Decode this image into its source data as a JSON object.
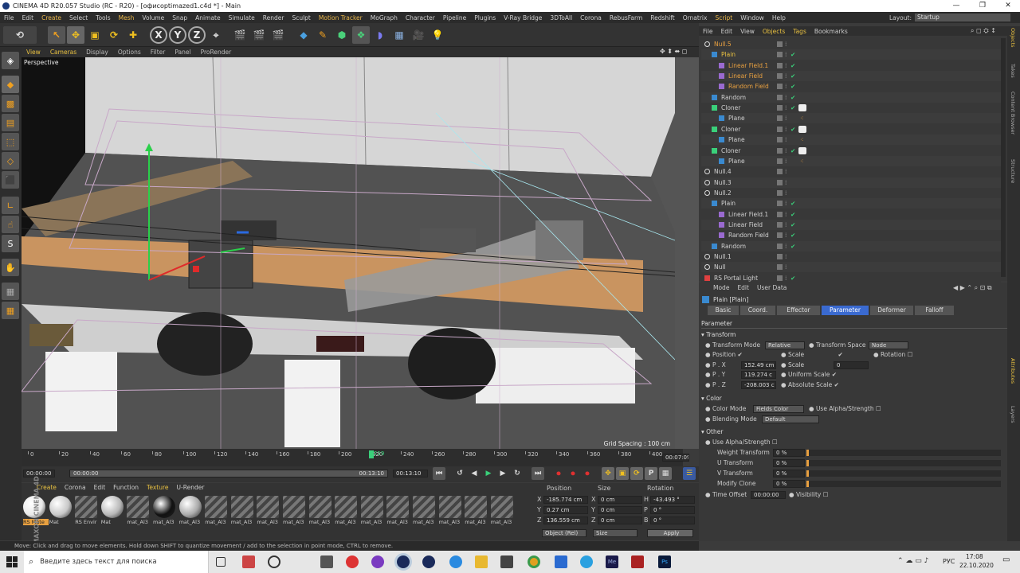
{
  "window": {
    "title": "CINEMA 4D R20.057 Studio (RC - R20) - [офисoptimazed1.c4d *] - Main",
    "min_label": "—",
    "max_label": "❐",
    "close_label": "✕"
  },
  "menu": {
    "items": [
      "File",
      "Edit",
      "Create",
      "Select",
      "Tools",
      "Mesh",
      "Volume",
      "Snap",
      "Animate",
      "Simulate",
      "Render",
      "Sculpt",
      "Motion Tracker",
      "MoGraph",
      "Character",
      "Pipeline",
      "Plugins",
      "V-Ray Bridge",
      "3DToAll",
      "Corona",
      "RebusFarm",
      "Redshift",
      "Ornatrix",
      "Script",
      "Window",
      "Help"
    ],
    "layout_label": "Layout:",
    "layout_value": "Startup"
  },
  "toolbar": {
    "axis_x": "X",
    "axis_y": "Y",
    "axis_z": "Z"
  },
  "viewport": {
    "menu": [
      "View",
      "Cameras",
      "Display",
      "Options",
      "Filter",
      "Panel",
      "ProRender"
    ],
    "camera_label": "Perspective",
    "grid_spacing": "Grid Spacing : 100 cm",
    "nav_icons": "✥ ⬍ ⬌ ◻"
  },
  "timeline": {
    "ticks": [
      "0",
      "20",
      "40",
      "60",
      "80",
      "100",
      "120",
      "140",
      "160",
      "180",
      "200",
      "220",
      "240",
      "260",
      "280",
      "300",
      "320",
      "340",
      "360",
      "380",
      "400"
    ],
    "current_frame": "219",
    "frame_field": "00:07:09"
  },
  "transport": {
    "start_time": "00:00:00",
    "min_time": "00:00:00",
    "max_time": "00:13:10",
    "end_time": "00:13:10"
  },
  "materials": {
    "menu": [
      "Create",
      "Corona",
      "Edit",
      "Function",
      "Texture",
      "U-Render"
    ],
    "items": [
      {
        "label": "RS Mate",
        "color": "#e9e9e9",
        "style": "sphere"
      },
      {
        "label": "Mat",
        "color": "#c8c8c8",
        "style": "sphere"
      },
      {
        "label": "RS Envir",
        "color": "#777",
        "style": "stripe"
      },
      {
        "label": "Mat",
        "color": "#b8b8b8",
        "style": "sphere"
      },
      {
        "label": "mat_Al3",
        "color": "#777",
        "style": "stripe"
      },
      {
        "label": "mat_Al3",
        "color": "#111",
        "style": "sphere"
      },
      {
        "label": "mat_Al3",
        "color": "#aaa",
        "style": "sphere"
      },
      {
        "label": "mat_Al3",
        "color": "#777",
        "style": "stripe"
      },
      {
        "label": "mat_Al3",
        "color": "#777",
        "style": "stripe"
      },
      {
        "label": "mat_Al3",
        "color": "#777",
        "style": "stripe"
      },
      {
        "label": "mat_Al3",
        "color": "#777",
        "style": "stripe"
      },
      {
        "label": "mat_Al3",
        "color": "#777",
        "style": "stripe"
      },
      {
        "label": "mat_Al3",
        "color": "#777",
        "style": "stripe"
      },
      {
        "label": "mat_Al3",
        "color": "#777",
        "style": "stripe"
      },
      {
        "label": "mat_Al3",
        "color": "#777",
        "style": "stripe"
      },
      {
        "label": "mat_Al3",
        "color": "#777",
        "style": "stripe"
      },
      {
        "label": "mat_Al3",
        "color": "#777",
        "style": "stripe"
      },
      {
        "label": "mat_Al3",
        "color": "#777",
        "style": "stripe"
      },
      {
        "label": "mat_Al3",
        "color": "#777",
        "style": "stripe"
      }
    ],
    "brand": "MAXON CINEMA 4D"
  },
  "coords": {
    "col_position": "Position",
    "col_size": "Size",
    "col_rotation": "Rotation",
    "rows": [
      {
        "axis": "X",
        "pos": "-185.774 cm",
        "saxis": "X",
        "size": "0 cm",
        "raxis": "H",
        "rot": "-43.493 °"
      },
      {
        "axis": "Y",
        "pos": "0.27 cm",
        "saxis": "Y",
        "size": "0 cm",
        "raxis": "P",
        "rot": "0 °"
      },
      {
        "axis": "Z",
        "pos": "136.559 cm",
        "saxis": "Z",
        "size": "0 cm",
        "raxis": "B",
        "rot": "0 °"
      }
    ],
    "mode_object": "Object (Rel)",
    "mode_size": "Size",
    "apply_label": "Apply"
  },
  "status": {
    "text": "Move: Click and drag to move elements. Hold down SHIFT to quantize movement / add to the selection in point mode, CTRL to remove."
  },
  "objects": {
    "menu": [
      "File",
      "Edit",
      "View",
      "Objects",
      "Tags",
      "Bookmarks"
    ],
    "rows": [
      {
        "name": "Null.5",
        "indent": 0,
        "type": "null",
        "color": "#e8a040",
        "check": false
      },
      {
        "name": "Plain",
        "indent": 1,
        "type": "effector",
        "color": "#e8c040",
        "check": true
      },
      {
        "name": "Linear Field.1",
        "indent": 2,
        "type": "field",
        "color": "#e8a040",
        "check": true
      },
      {
        "name": "Linear Field",
        "indent": 2,
        "type": "field",
        "color": "#e8a040",
        "check": true
      },
      {
        "name": "Random Field",
        "indent": 2,
        "type": "field",
        "color": "#e8a040",
        "check": true
      },
      {
        "name": "Random",
        "indent": 1,
        "type": "effector",
        "color": "#d0d0d0",
        "check": true
      },
      {
        "name": "Cloner",
        "indent": 1,
        "type": "cloner",
        "color": "#d0d0d0",
        "check": true
      },
      {
        "name": "Plane",
        "indent": 2,
        "type": "plane",
        "color": "#d0d0d0",
        "check": false
      },
      {
        "name": "Cloner",
        "indent": 1,
        "type": "cloner",
        "color": "#d0d0d0",
        "check": true
      },
      {
        "name": "Plane",
        "indent": 2,
        "type": "plane",
        "color": "#d0d0d0",
        "check": false
      },
      {
        "name": "Cloner",
        "indent": 1,
        "type": "cloner",
        "color": "#d0d0d0",
        "check": true
      },
      {
        "name": "Plane",
        "indent": 2,
        "type": "plane",
        "color": "#d0d0d0",
        "check": false
      },
      {
        "name": "Null.4",
        "indent": 0,
        "type": "null",
        "color": "#d0d0d0",
        "check": false
      },
      {
        "name": "Null.3",
        "indent": 0,
        "type": "null",
        "color": "#d0d0d0",
        "check": false
      },
      {
        "name": "Null.2",
        "indent": 0,
        "type": "null",
        "color": "#d0d0d0",
        "check": false
      },
      {
        "name": "Plain",
        "indent": 1,
        "type": "effector",
        "color": "#d0d0d0",
        "check": true
      },
      {
        "name": "Linear Field.1",
        "indent": 2,
        "type": "field",
        "color": "#d0d0d0",
        "check": true
      },
      {
        "name": "Linear Field",
        "indent": 2,
        "type": "field",
        "color": "#d0d0d0",
        "check": true
      },
      {
        "name": "Random Field",
        "indent": 2,
        "type": "field",
        "color": "#d0d0d0",
        "check": true
      },
      {
        "name": "Random",
        "indent": 1,
        "type": "effector",
        "color": "#d0d0d0",
        "check": true
      },
      {
        "name": "Null.1",
        "indent": 0,
        "type": "null",
        "color": "#d0d0d0",
        "check": false
      },
      {
        "name": "Null",
        "indent": 0,
        "type": "null",
        "color": "#d0d0d0",
        "check": false
      },
      {
        "name": "RS Portal Light",
        "indent": 0,
        "type": "light",
        "color": "#d0d0d0",
        "check": true
      }
    ]
  },
  "attributes": {
    "menu": [
      "Mode",
      "Edit",
      "User Data"
    ],
    "object_title": "Plain [Plain]",
    "tabs": [
      "Basic",
      "Coord.",
      "Effector",
      "Parameter",
      "Deformer",
      "Falloff"
    ],
    "active_tab": "Parameter",
    "section_parameter": "Parameter",
    "section_transform": "Transform",
    "transform_mode_label": "Transform Mode",
    "transform_mode_value": "Relative",
    "transform_space_label": "Transform Space",
    "transform_space_value": "Node",
    "position_label": "Position",
    "scale_label": "Scale",
    "rotation_label": "Rotation",
    "px_label": "P . X",
    "px_value": "152.49 cm",
    "py_label": "P . Y",
    "py_value": "119.274 c",
    "pz_label": "P . Z",
    "pz_value": "-208.003 c",
    "scale_field_label": "Scale",
    "scale_value": "0",
    "uniform_scale_label": "Uniform Scale",
    "absolute_scale_label": "Absolute Scale",
    "section_color": "Color",
    "color_mode_label": "Color Mode",
    "color_mode_value": "Fields Color",
    "use_alpha_label": "Use Alpha/Strength",
    "blending_mode_label": "Blending Mode",
    "blending_mode_value": "Default",
    "section_other": "Other",
    "use_alpha_other_label": "Use Alpha/Strength",
    "weight_transform_label": "Weight Transform",
    "weight_transform_value": "0 %",
    "u_transform_label": "U Transform",
    "u_transform_value": "0 %",
    "v_transform_label": "V Transform",
    "v_transform_value": "0 %",
    "modify_clone_label": "Modify Clone",
    "modify_clone_value": "0 %",
    "time_offset_label": "Time Offset",
    "time_offset_value": "00:00:00",
    "visibility_label": "Visibility"
  },
  "right_strip": [
    "Objects",
    "Takes",
    "Content Browser",
    "Structure",
    "Attributes",
    "Layers"
  ],
  "taskbar": {
    "search_placeholder": "Введите здесь текст для поиска",
    "lang": "РУС",
    "time": "17:08",
    "date": "22.10.2020"
  }
}
